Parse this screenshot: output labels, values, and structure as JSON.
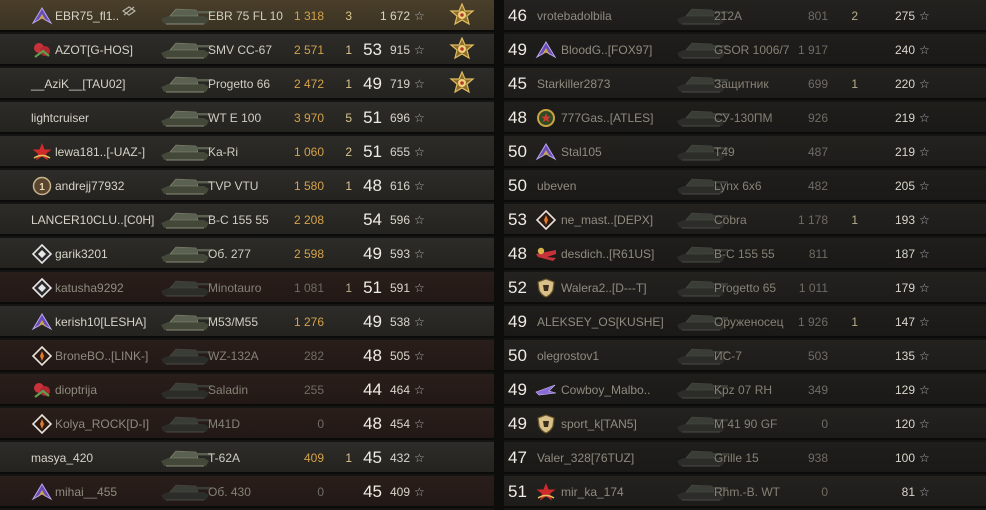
{
  "left_team": [
    {
      "name": "EBR75_fl1..",
      "badge": "purple-chevron-icon",
      "tank": "EBR 75 FL 10",
      "damage": "1 318",
      "frags": "3",
      "level": "",
      "xp": "1 672",
      "medal": true,
      "platoon": true,
      "state": "player"
    },
    {
      "name": "AZOT[G-HOS]",
      "badge": "red-flower-icon",
      "tank": "SMV CC-67",
      "damage": "2 571",
      "frags": "1",
      "level": "53",
      "xp": "915",
      "medal": true,
      "state": "alive"
    },
    {
      "name": "__AziK__[TAU02]",
      "badge": "",
      "tank": "Progetto 66",
      "damage": "2 472",
      "frags": "1",
      "level": "49",
      "xp": "719",
      "medal": true,
      "state": "alive"
    },
    {
      "name": "lightcruiser",
      "badge": "",
      "tank": "WT E 100",
      "damage": "3 970",
      "frags": "5",
      "level": "51",
      "xp": "696",
      "state": "alive"
    },
    {
      "name": "lewa181..[-UAZ-]",
      "badge": "red-star-icon",
      "tank": "Ka-Ri",
      "damage": "1 060",
      "frags": "2",
      "level": "51",
      "xp": "655",
      "state": "alive"
    },
    {
      "name": "andrejj77932",
      "badge": "brown-coin-icon",
      "tank": "TVP VTU",
      "damage": "1 580",
      "frags": "1",
      "level": "48",
      "xp": "616",
      "state": "alive"
    },
    {
      "name": "LANCER10CLU..[C0H]",
      "badge": "",
      "tank": "B-C 155 55",
      "damage": "2 208",
      "frags": "",
      "level": "54",
      "xp": "596",
      "state": "alive"
    },
    {
      "name": "garik3201",
      "badge": "white-diamond-icon",
      "tank": "Об. 277",
      "damage": "2 598",
      "frags": "",
      "level": "49",
      "xp": "593",
      "state": "alive"
    },
    {
      "name": "katusha9292",
      "badge": "white-diamond-icon",
      "tank": "Minotauro",
      "damage": "1 081",
      "frags": "1",
      "level": "51",
      "xp": "591",
      "state": "dead"
    },
    {
      "name": "kerish10[LESHA]",
      "badge": "purple-chevron-icon",
      "tank": "M53/M55",
      "damage": "1 276",
      "frags": "",
      "level": "49",
      "xp": "538",
      "state": "alive"
    },
    {
      "name": "BroneBO..[LINK-]",
      "badge": "orange-diamond-icon",
      "tank": "WZ-132A",
      "damage": "282",
      "frags": "",
      "level": "48",
      "xp": "505",
      "state": "dead"
    },
    {
      "name": "dioptrija",
      "badge": "red-flower-icon",
      "tank": "Saladin",
      "damage": "255",
      "frags": "",
      "level": "44",
      "xp": "464",
      "state": "dead"
    },
    {
      "name": "Kolya_ROCK[D-I]",
      "badge": "orange-diamond-icon",
      "tank": "M41D",
      "damage": "0",
      "frags": "",
      "level": "48",
      "xp": "454",
      "state": "dead"
    },
    {
      "name": "masya_420",
      "badge": "",
      "tank": "T-62A",
      "damage": "409",
      "frags": "1",
      "level": "45",
      "xp": "432",
      "state": "alive"
    },
    {
      "name": "mihai__455",
      "badge": "purple-chevron-icon",
      "tank": "Об. 430",
      "damage": "0",
      "frags": "",
      "level": "45",
      "xp": "409",
      "state": "dead"
    }
  ],
  "right_team": [
    {
      "level": "46",
      "name": "vrotebadolbila",
      "badge": "",
      "tank": "212A",
      "damage": "801",
      "frags": "2",
      "xp": "275"
    },
    {
      "level": "49",
      "name": "BloodG..[FOX97]",
      "badge": "purple-chevron-icon",
      "tank": "GSOR 1006/7",
      "damage": "1 917",
      "frags": "",
      "xp": "240"
    },
    {
      "level": "45",
      "name": "Starkiller2873",
      "badge": "",
      "tank": "Защитник",
      "damage": "699",
      "frags": "1",
      "xp": "220"
    },
    {
      "level": "48",
      "name": "777Gas..[ATLES]",
      "badge": "green-wreath-icon",
      "tank": "СУ-130ПМ",
      "damage": "926",
      "frags": "",
      "xp": "219"
    },
    {
      "level": "50",
      "name": "Stal105",
      "badge": "purple-chevron-icon",
      "tank": "T49",
      "damage": "487",
      "frags": "",
      "xp": "219"
    },
    {
      "level": "50",
      "name": "ubeven",
      "badge": "",
      "tank": "Lynx 6x6",
      "damage": "482",
      "frags": "",
      "xp": "205"
    },
    {
      "level": "53",
      "name": "ne_mast..[DEPX]",
      "badge": "orange-diamond-icon",
      "tank": "Cobra",
      "damage": "1 178",
      "frags": "1",
      "xp": "193"
    },
    {
      "level": "48",
      "name": "desdich..[R61US]",
      "badge": "red-wing-icon",
      "tank": "B-C 155 55",
      "damage": "811",
      "frags": "",
      "xp": "187"
    },
    {
      "level": "52",
      "name": "Walera2..[D---T]",
      "badge": "gold-shield-icon",
      "tank": "Progetto 65",
      "damage": "1 011",
      "frags": "",
      "xp": "179"
    },
    {
      "level": "49",
      "name": "ALEKSEY_OS[KUSHE]",
      "badge": "",
      "tank": "Оруженосец",
      "damage": "1 926",
      "frags": "1",
      "xp": "147"
    },
    {
      "level": "50",
      "name": "olegrostov1",
      "badge": "",
      "tank": "ИС-7",
      "damage": "503",
      "frags": "",
      "xp": "135"
    },
    {
      "level": "49",
      "name": "Cowboy_Malbo..",
      "badge": "purple-wing-icon",
      "tank": "Kpz 07 RH",
      "damage": "349",
      "frags": "",
      "xp": "129"
    },
    {
      "level": "49",
      "name": "sport_k[TAN5]",
      "badge": "gold-shield-icon",
      "tank": "M 41 90 GF",
      "damage": "0",
      "frags": "",
      "xp": "120"
    },
    {
      "level": "47",
      "name": "Valer_328[76TUZ]",
      "badge": "",
      "tank": "Grille 15",
      "damage": "938",
      "frags": "",
      "xp": "100"
    },
    {
      "level": "51",
      "name": "mir_ka_174",
      "badge": "red-star-icon",
      "tank": "Rhm.-B. WT",
      "damage": "0",
      "frags": "",
      "xp": "81"
    }
  ],
  "colors": {
    "damage_gold": "#d4a24a",
    "text_light": "#d6d3c8",
    "star_grey": "#aeb0b0"
  },
  "xp_icon": "star-icon"
}
